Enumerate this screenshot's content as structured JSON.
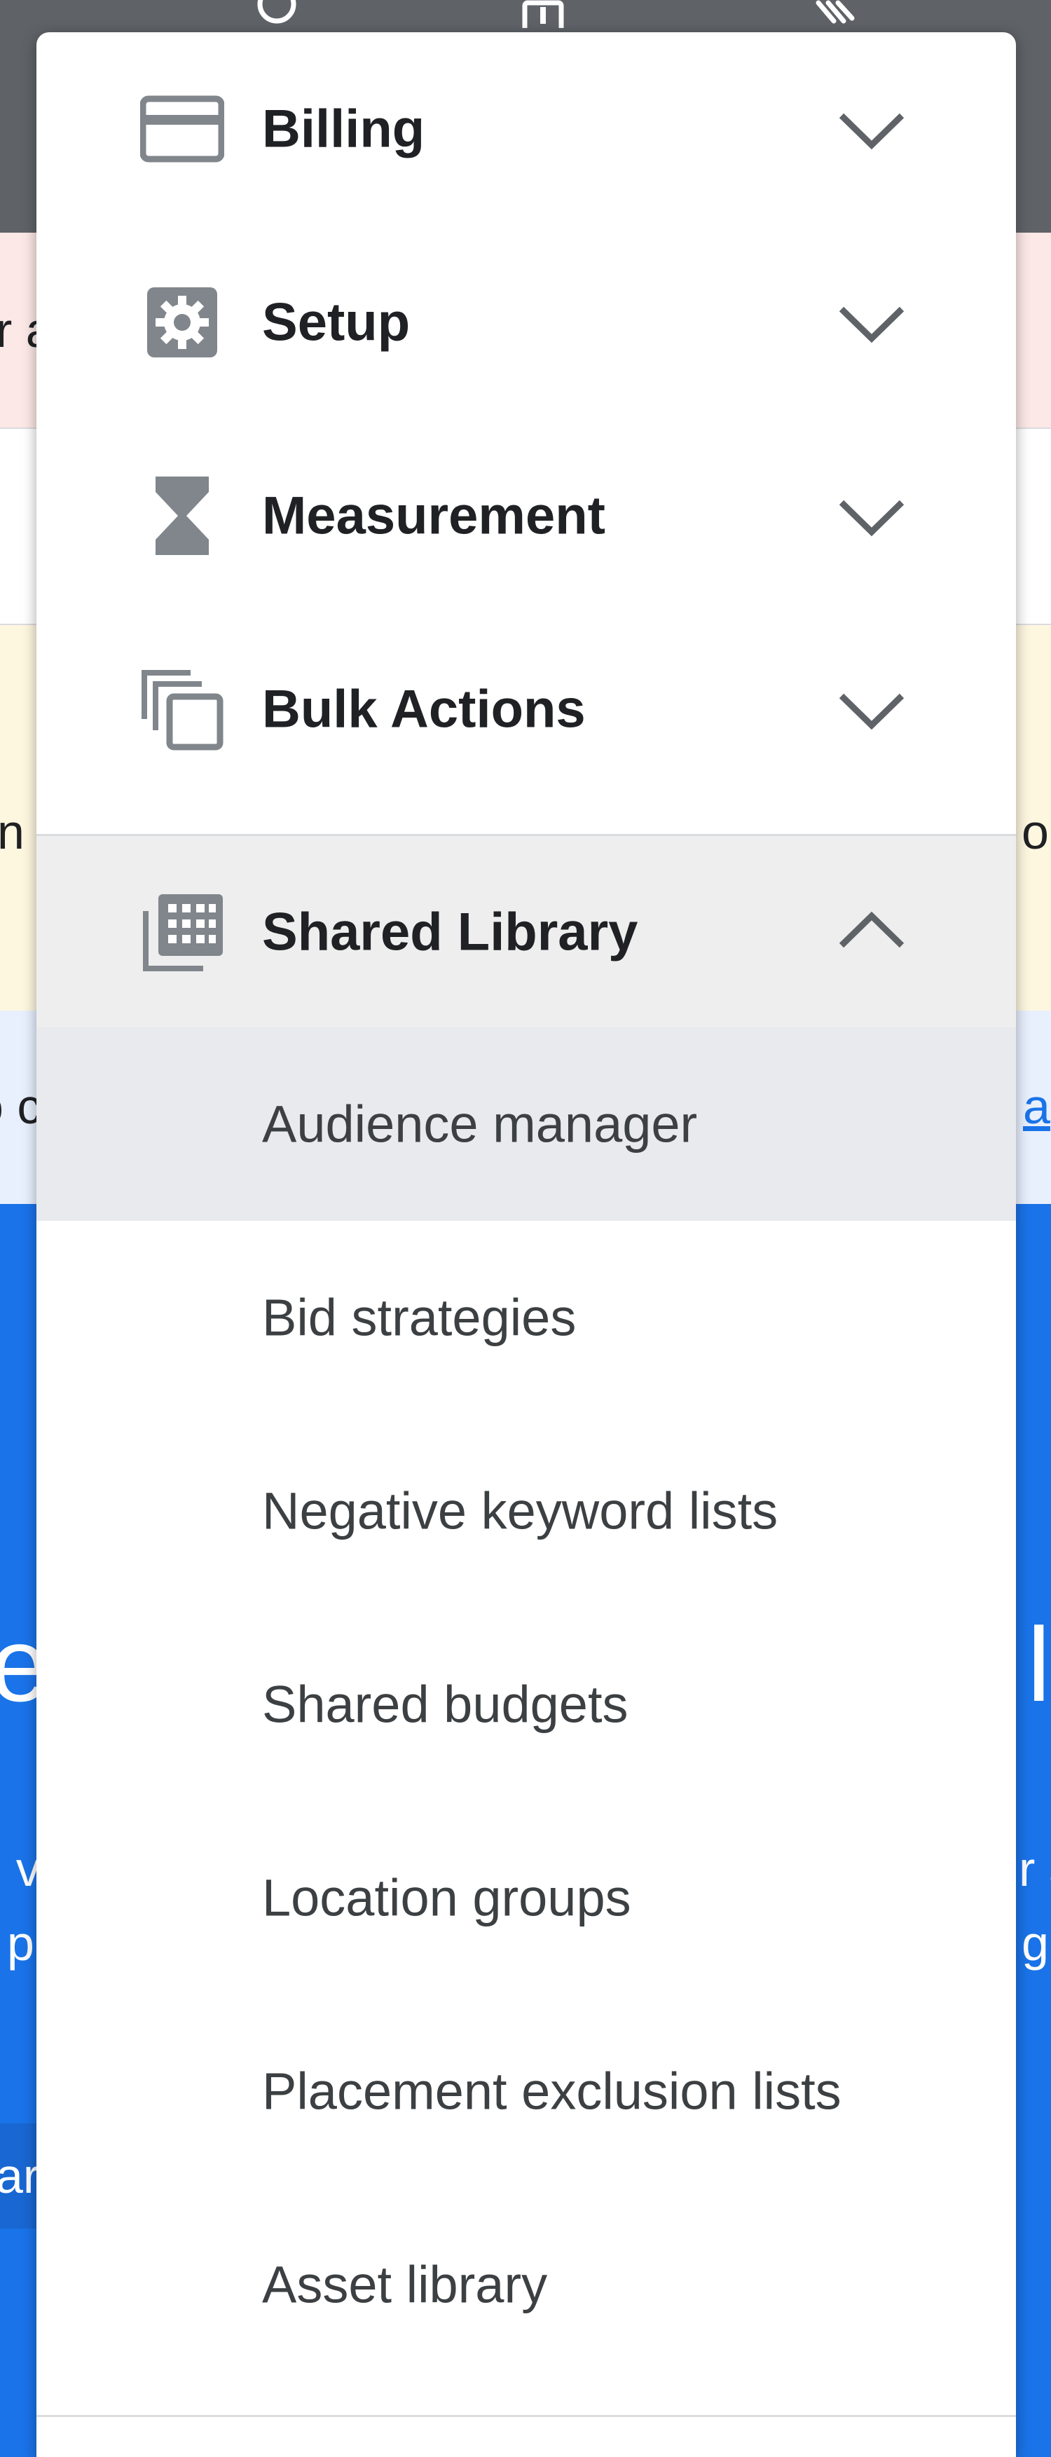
{
  "background": {
    "edge_texts": {
      "pink_left": "r a",
      "yellow_left": "n",
      "yellow_right": "o",
      "lightblue_left": "o c",
      "lightblue_right": "a",
      "blue_big_left": "e",
      "blue_big_right": "l",
      "blue_line1_left": ", v",
      "blue_line1_right": "r a",
      "blue_line2_left": "p",
      "blue_line2_right": "g",
      "blue_button_left": "ar"
    }
  },
  "menu": {
    "items": [
      {
        "label": "Billing",
        "icon": "credit-card-icon",
        "state": "collapsed"
      },
      {
        "label": "Setup",
        "icon": "settings-icon",
        "state": "collapsed"
      },
      {
        "label": "Measurement",
        "icon": "hourglass-icon",
        "state": "collapsed"
      },
      {
        "label": "Bulk Actions",
        "icon": "copy-icon",
        "state": "collapsed"
      },
      {
        "label": "Shared Library",
        "icon": "library-icon",
        "state": "expanded"
      }
    ],
    "shared_library_subitems": [
      {
        "label": "Audience manager",
        "active": true
      },
      {
        "label": "Bid strategies",
        "active": false
      },
      {
        "label": "Negative keyword lists",
        "active": false
      },
      {
        "label": "Shared budgets",
        "active": false
      },
      {
        "label": "Location groups",
        "active": false
      },
      {
        "label": "Placement exclusion lists",
        "active": false
      },
      {
        "label": "Asset library",
        "active": false
      }
    ]
  },
  "colors": {
    "menu_background": "#ffffff",
    "expanded_header_background": "#eeeeee",
    "active_subitem_background": "#e8eaed",
    "icon_gray": "#80868b",
    "text_primary": "#202124",
    "background_blue": "#1a73e8",
    "topbar_gray": "#5f6368"
  }
}
